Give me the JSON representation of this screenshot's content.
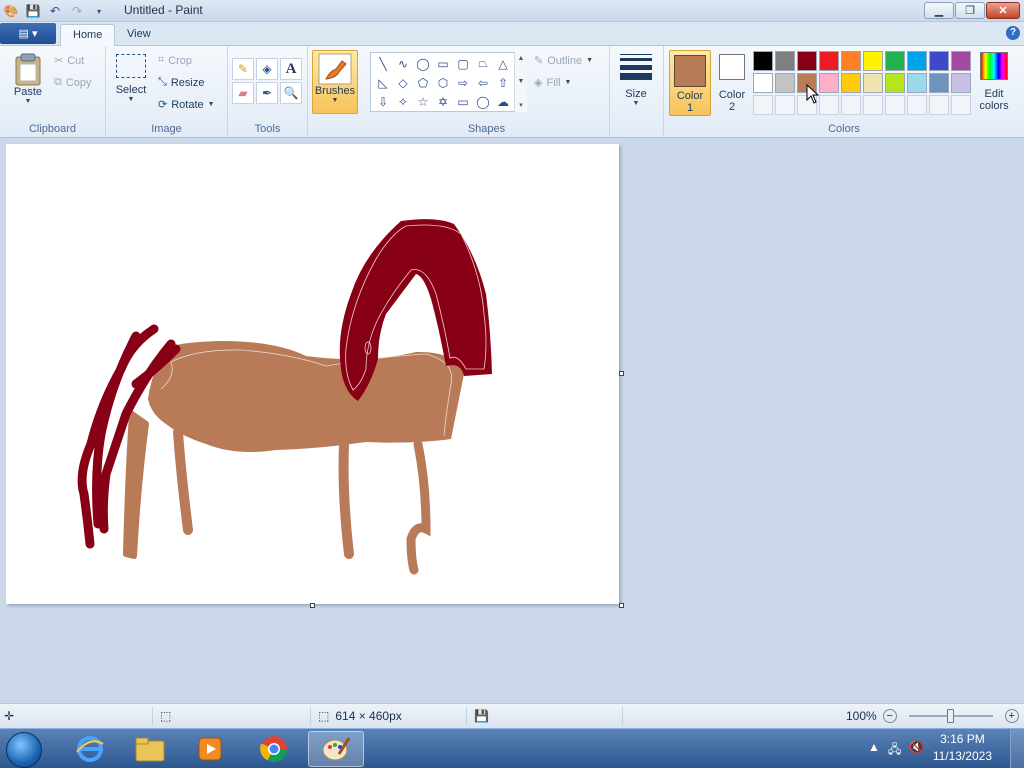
{
  "window": {
    "title": "Untitled - Paint",
    "minimize_icon": "minimize-icon",
    "restore_icon": "restore-icon",
    "close_icon": "close-icon"
  },
  "tabs": [
    {
      "label": "Home",
      "active": true
    },
    {
      "label": "View",
      "active": false
    }
  ],
  "ribbon": {
    "clipboard": {
      "label": "Clipboard",
      "paste": "Paste",
      "cut": "Cut",
      "copy": "Copy"
    },
    "image": {
      "label": "Image",
      "select": "Select",
      "crop": "Crop",
      "resize": "Resize",
      "rotate": "Rotate"
    },
    "tools": {
      "label": "Tools",
      "items": [
        "pencil-icon",
        "fill-bucket-icon",
        "text-icon",
        "eraser-icon",
        "color-picker-icon",
        "magnifier-icon"
      ]
    },
    "brushes": {
      "label": "Brushes"
    },
    "shapes": {
      "label": "Shapes",
      "outline": "Outline",
      "fill": "Fill",
      "items": [
        "line",
        "curve",
        "oval",
        "rectangle",
        "rounded-rectangle",
        "polygon",
        "triangle",
        "right-triangle",
        "diamond",
        "pentagon",
        "hexagon",
        "right-arrow",
        "left-arrow",
        "up-arrow",
        "down-arrow",
        "four-point-star",
        "five-point-star",
        "six-point-star",
        "rounded-callout",
        "oval-callout",
        "cloud-callout"
      ]
    },
    "size": {
      "label": "Size"
    },
    "colors": {
      "label": "Colors",
      "color1_label": "Color",
      "color1_num": "1",
      "color2_label": "Color",
      "color2_num": "2",
      "color1_value": "#b97a57",
      "color2_value": "#ffffff",
      "edit_label": "Edit",
      "edit_label2": "colors",
      "palette_row1": [
        "#000000",
        "#7f7f7f",
        "#880015",
        "#ed1c24",
        "#ff7f27",
        "#fff200",
        "#22b14c",
        "#00a2e8",
        "#3f48cc",
        "#a349a4"
      ],
      "palette_row2": [
        "#ffffff",
        "#c3c3c3",
        "#b97a57",
        "#ffaec9",
        "#ffc90e",
        "#efe4b0",
        "#b5e61d",
        "#99d9ea",
        "#7092be",
        "#c8bfe7"
      ]
    }
  },
  "canvas": {
    "drawing_colors": {
      "body": "#b97a57",
      "mane": "#880015"
    }
  },
  "status": {
    "image_size": "614 × 460px",
    "zoom": "100%",
    "zoom_level": 0.5
  },
  "taskbar": {
    "apps": [
      "internet-explorer-icon",
      "file-explorer-icon",
      "media-player-icon",
      "chrome-icon",
      "paint-icon"
    ],
    "time": "3:16 PM",
    "date": "11/13/2023"
  }
}
